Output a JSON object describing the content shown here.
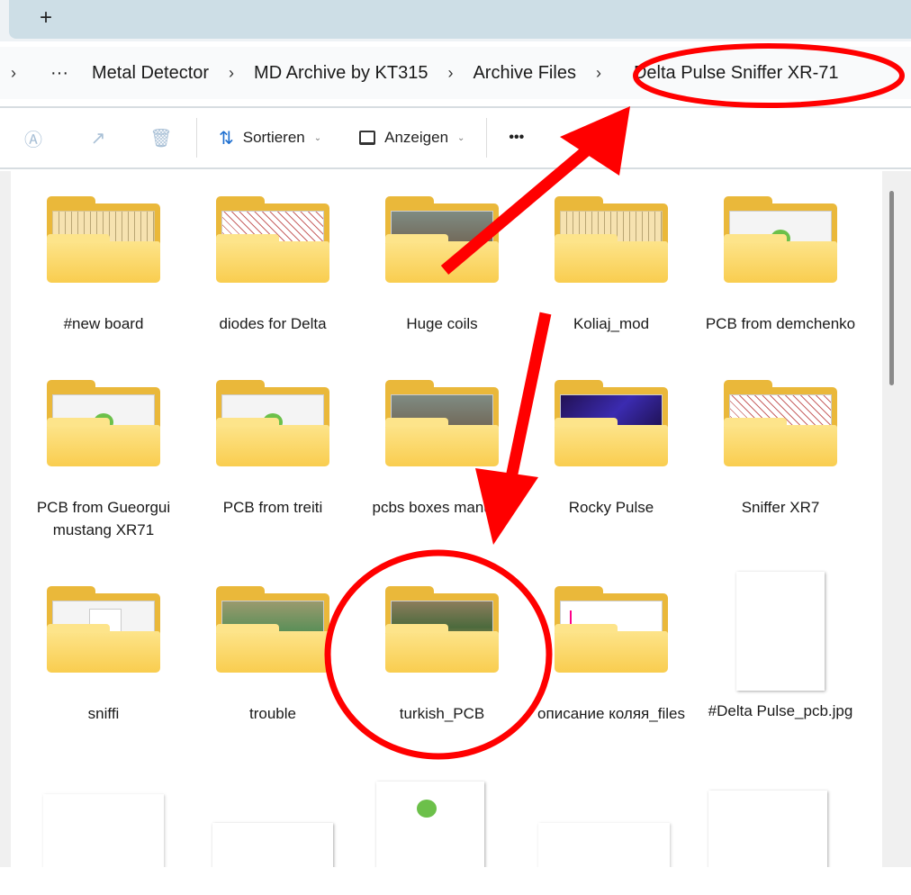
{
  "tabbar": {
    "new_tab_label": "+"
  },
  "breadcrumb": {
    "expand": "›",
    "overflow": "···",
    "items": [
      "Metal Detector",
      "MD Archive by KT315",
      "Archive Files",
      "Delta Pulse Sniffer XR-71"
    ],
    "separator": "›"
  },
  "toolbar": {
    "rename_icon": "rename-icon",
    "share_icon": "share-icon",
    "delete_icon": "trash-icon",
    "sort_label": "Sortieren",
    "view_label": "Anzeigen",
    "more_label": "•••"
  },
  "items": [
    {
      "name": "#new board",
      "type": "folder",
      "preview": "schem"
    },
    {
      "name": "diodes for Delta",
      "type": "folder",
      "preview": "red"
    },
    {
      "name": "Huge coils",
      "type": "folder",
      "preview": "photo"
    },
    {
      "name": "Koliaj_mod",
      "type": "folder",
      "preview": "schem"
    },
    {
      "name": "PCB from demchenko",
      "type": "folder",
      "preview": "np"
    },
    {
      "name": "PCB from Gueorgui mustang XR71",
      "type": "folder",
      "preview": "np"
    },
    {
      "name": "PCB from treiti",
      "type": "folder",
      "preview": "np"
    },
    {
      "name": "pcbs boxes manuals",
      "type": "folder",
      "preview": "photo"
    },
    {
      "name": "Rocky Pulse",
      "type": "folder",
      "preview": "pcb"
    },
    {
      "name": "Sniffer XR7",
      "type": "folder",
      "preview": "red"
    },
    {
      "name": "sniffi",
      "type": "folder",
      "preview": "doc"
    },
    {
      "name": "trouble",
      "type": "folder",
      "preview": "board"
    },
    {
      "name": "turkish_PCB",
      "type": "folder",
      "preview": "pcbbox"
    },
    {
      "name": "описание коляя_files",
      "type": "folder",
      "preview": "graph"
    },
    {
      "name": "#Delta Pulse_pcb.jpg",
      "type": "image"
    }
  ],
  "colors": {
    "annotation": "#ff0000",
    "folder": "#f9cd4f"
  }
}
